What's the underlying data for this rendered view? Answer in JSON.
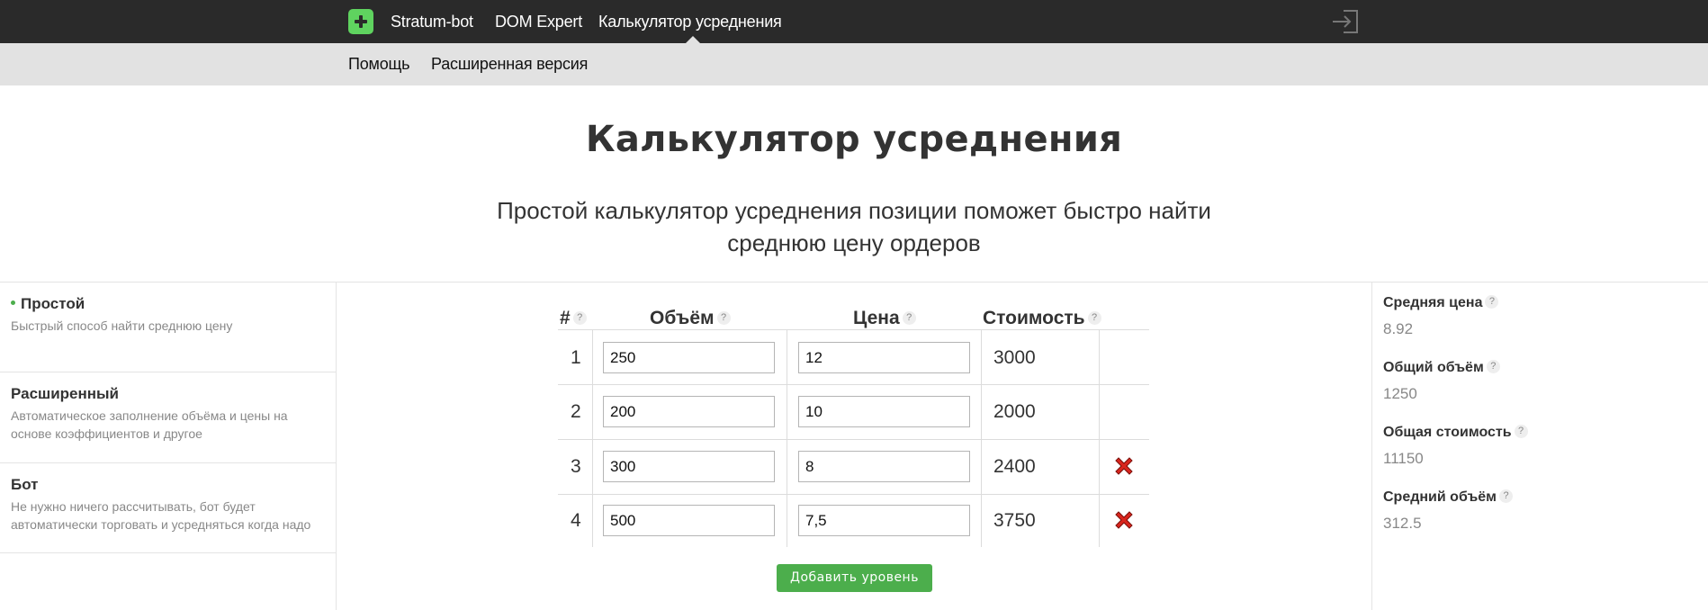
{
  "nav": {
    "brand_icon": "plus-square-icon",
    "links": [
      "Stratum-bot",
      "DOM Expert",
      "Калькулятор усреднения"
    ],
    "active": "Калькулятор усреднения",
    "logout_icon": "sign-in-icon"
  },
  "subnav": {
    "links": [
      "Помощь",
      "Расширенная версия"
    ]
  },
  "page": {
    "title": "Калькулятор усреднения",
    "subtitle_line1": "Простой калькулятор усреднения позиции поможет быстро найти",
    "subtitle_line2": "среднюю цену ордеров"
  },
  "sidebar": {
    "items": [
      {
        "title": "Простой",
        "desc_lines": [
          "Быстрый способ найти среднюю цену"
        ],
        "active": true
      },
      {
        "title": "Расширенный",
        "desc_lines": [
          "Автоматическое заполнение объёма и цены на",
          "основе коэффициентов и другое"
        ],
        "active": false
      },
      {
        "title": "Бот",
        "desc_lines": [
          "Не нужно ничего рассчитывать, бот будет",
          "автоматически торговать и усредняться когда надо"
        ],
        "active": false
      }
    ]
  },
  "table": {
    "headers": {
      "num": "#",
      "volume": "Объём",
      "price": "Цена",
      "cost": "Стоимость",
      "help": "?"
    },
    "rows": [
      {
        "n": "1",
        "volume": "250",
        "price": "12",
        "cost": "3000",
        "deletable": false
      },
      {
        "n": "2",
        "volume": "200",
        "price": "10",
        "cost": "2000",
        "deletable": false
      },
      {
        "n": "3",
        "volume": "300",
        "price": "8",
        "cost": "2400",
        "deletable": true
      },
      {
        "n": "4",
        "volume": "500",
        "price": "7,5",
        "cost": "3750",
        "deletable": true
      }
    ],
    "add_button": "Добавить уровень",
    "delete_color": "#d9251d"
  },
  "stats": [
    {
      "label": "Средняя цена",
      "value": "8.92"
    },
    {
      "label": "Общий объём",
      "value": "1250"
    },
    {
      "label": "Общая стоимость",
      "value": "11150"
    },
    {
      "label": "Средний объём",
      "value": "312.5"
    }
  ],
  "colors": {
    "nav_bg": "#2a2a2a",
    "subnav_bg": "#e2e2e2",
    "accent": "#5fd35f",
    "button": "#4cae4c"
  }
}
